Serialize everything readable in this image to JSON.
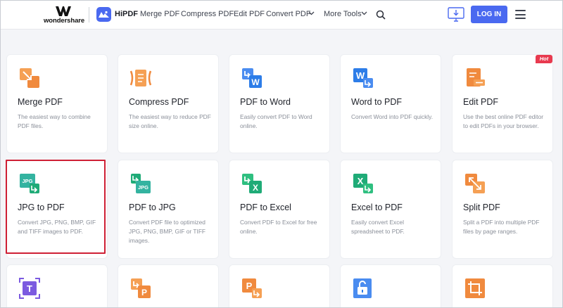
{
  "header": {
    "brand_name": "wondershare",
    "product_name": "HiPDF",
    "nav": [
      "Merge PDF",
      "Compress PDF",
      "Edit PDF",
      "Convert PDF",
      "More Tools"
    ],
    "login_label": "LOG IN"
  },
  "hot_badge": "Hot",
  "colors": {
    "accent": "#4a69f0",
    "orange": "#f08a3e",
    "blue": "#2d7de8",
    "green": "#1fab77",
    "teal": "#33b3a0",
    "purple": "#7b5ae0",
    "highlight": "#cf2035",
    "hot": "#e83a4f"
  },
  "tools": [
    {
      "title": "Merge PDF",
      "desc": "The easiest way to combine PDF files.",
      "icon": "merge-icon"
    },
    {
      "title": "Compress PDF",
      "desc": "The easiest way to reduce PDF size online.",
      "icon": "compress-icon"
    },
    {
      "title": "PDF to Word",
      "desc": "Easily convert PDF to Word online.",
      "icon": "pdf-to-word-icon"
    },
    {
      "title": "Word to PDF",
      "desc": "Convert Word into PDF quickly.",
      "icon": "word-to-pdf-icon"
    },
    {
      "title": "Edit PDF",
      "desc": "Use the best online PDF editor to edit PDFs in your browser.",
      "icon": "edit-icon"
    },
    {
      "title": "JPG to PDF",
      "desc": "Convert JPG, PNG, BMP, GIF and TIFF images to PDF.",
      "icon": "jpg-to-pdf-icon"
    },
    {
      "title": "PDF to JPG",
      "desc": "Convert PDF file to optimized JPG, PNG, BMP, GIF or TIFF images.",
      "icon": "pdf-to-jpg-icon"
    },
    {
      "title": "PDF to Excel",
      "desc": "Convert PDF to Excel for free online.",
      "icon": "pdf-to-excel-icon"
    },
    {
      "title": "Excel to PDF",
      "desc": "Easily convert Excel spreadsheet to PDF.",
      "icon": "excel-to-pdf-icon"
    },
    {
      "title": "Split PDF",
      "desc": "Split a PDF into multiple PDF files by page ranges.",
      "icon": "split-icon"
    }
  ],
  "icon_labels": {
    "jpg": "JPG",
    "w": "W",
    "x": "X",
    "p": "P",
    "t": "T"
  }
}
